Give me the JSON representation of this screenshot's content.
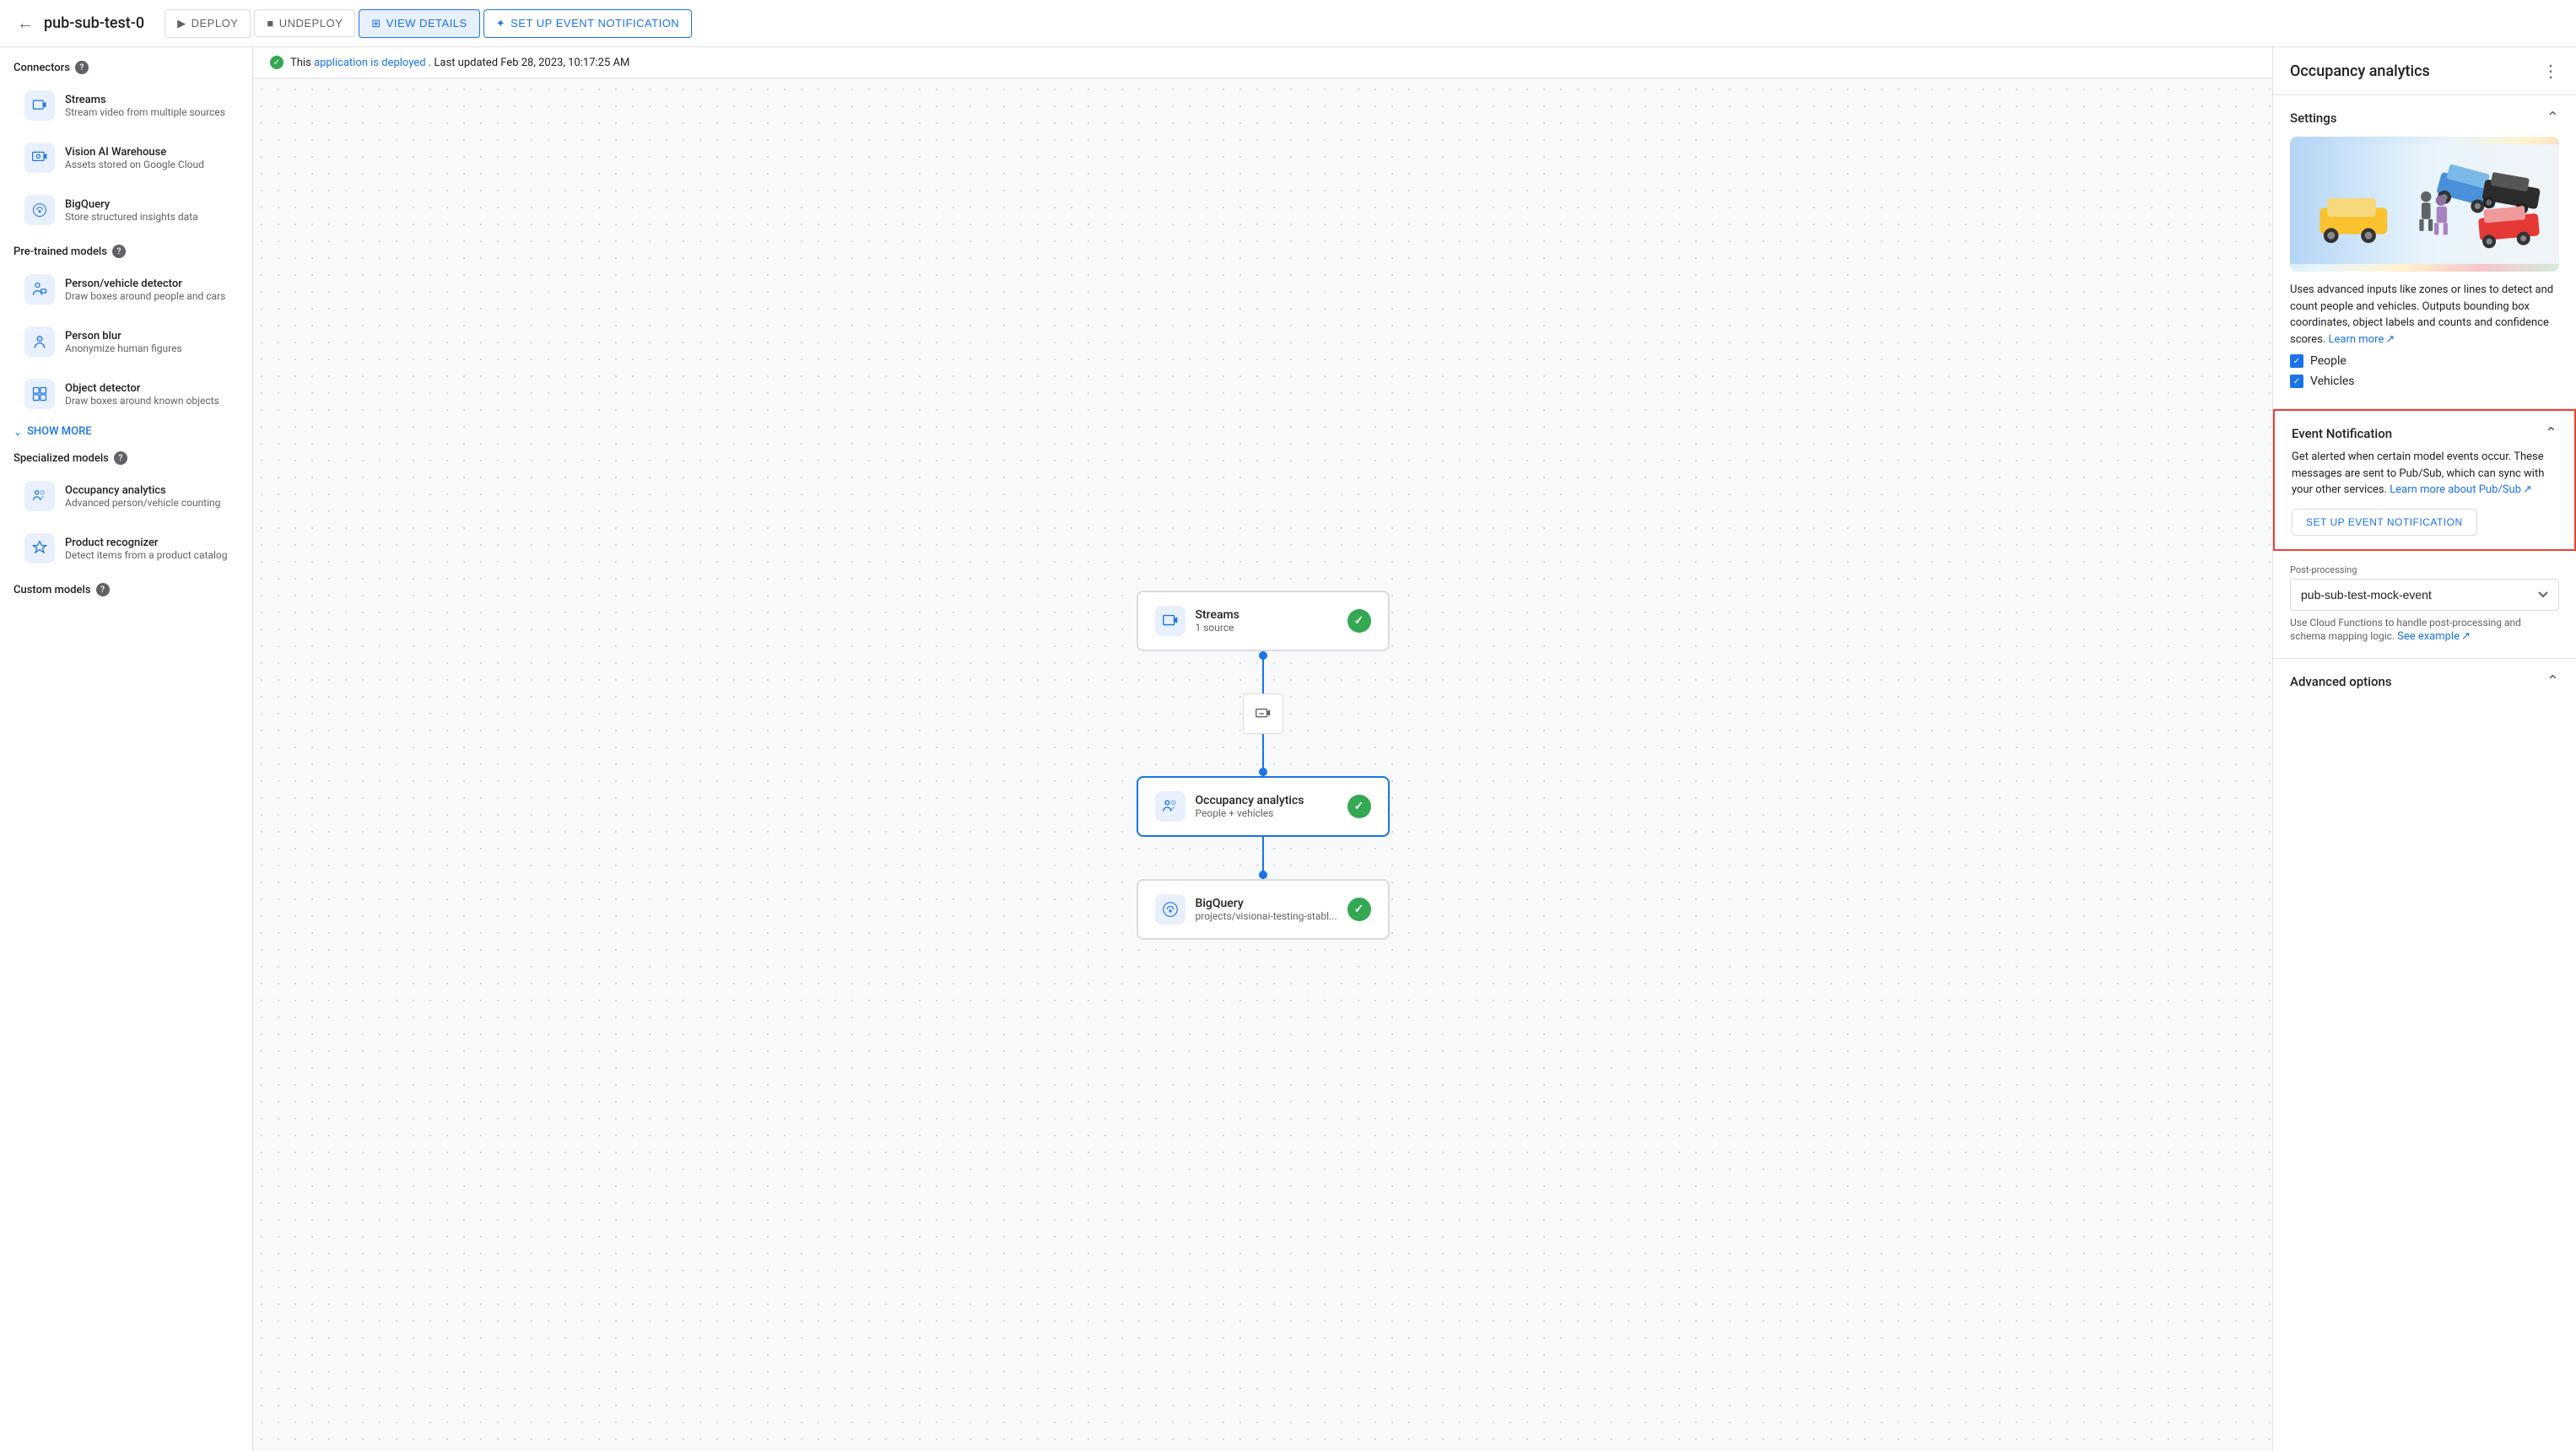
{
  "topbar": {
    "title": "pub-sub-test-0",
    "back_icon": "←",
    "buttons": [
      {
        "id": "deploy",
        "label": "DEPLOY",
        "icon": "▶",
        "style": "default"
      },
      {
        "id": "undeploy",
        "label": "UNDEPLOY",
        "icon": "■",
        "style": "default"
      },
      {
        "id": "view-details",
        "label": "VIEW DETAILS",
        "icon": "⊞",
        "style": "active"
      },
      {
        "id": "setup-event",
        "label": "SET UP EVENT NOTIFICATION",
        "icon": "✦",
        "style": "outlined-blue"
      }
    ]
  },
  "status_bar": {
    "text_prefix": "This",
    "link_text": "application is deployed",
    "text_suffix": ". Last updated Feb 28, 2023, 10:17:25 AM"
  },
  "sidebar": {
    "connectors_title": "Connectors",
    "connectors": [
      {
        "id": "streams",
        "name": "Streams",
        "desc": "Stream video from multiple sources",
        "icon_type": "streams"
      },
      {
        "id": "vision-ai",
        "name": "Vision AI Warehouse",
        "desc": "Assets stored on Google Cloud",
        "icon_type": "vision"
      },
      {
        "id": "bigquery",
        "name": "BigQuery",
        "desc": "Store structured insights data",
        "icon_type": "bq"
      }
    ],
    "pretrained_title": "Pre-trained models",
    "pretrained": [
      {
        "id": "person-vehicle",
        "name": "Person/vehicle detector",
        "desc": "Draw boxes around people and cars",
        "icon_type": "person"
      },
      {
        "id": "person-blur",
        "name": "Person blur",
        "desc": "Anonymize human figures",
        "icon_type": "blur"
      },
      {
        "id": "object-detector",
        "name": "Object detector",
        "desc": "Draw boxes around known objects",
        "icon_type": "object"
      }
    ],
    "show_more": "SHOW MORE",
    "specialized_title": "Specialized models",
    "specialized": [
      {
        "id": "occupancy",
        "name": "Occupancy analytics",
        "desc": "Advanced person/vehicle counting",
        "icon_type": "occupancy"
      },
      {
        "id": "product",
        "name": "Product recognizer",
        "desc": "Detect items from a product catalog",
        "icon_type": "product"
      }
    ],
    "custom_title": "Custom models"
  },
  "pipeline": {
    "nodes": [
      {
        "id": "streams-node",
        "name": "Streams",
        "sub": "1 source",
        "icon_type": "streams",
        "checked": true,
        "selected": false
      },
      {
        "id": "occupancy-node",
        "name": "Occupancy analytics",
        "sub": "People + vehicles",
        "icon_type": "occupancy",
        "checked": true,
        "selected": true
      },
      {
        "id": "bigquery-node",
        "name": "BigQuery",
        "sub": "projects/visionai-testing-stabl...",
        "icon_type": "bq",
        "checked": true,
        "selected": false
      }
    ]
  },
  "right_panel": {
    "title": "Occupancy analytics",
    "settings_title": "Settings",
    "description": "Uses advanced inputs like zones or lines to detect and count people and vehicles. Outputs bounding box coordinates, object labels and counts and confidence scores.",
    "learn_more_text": "Learn more",
    "checkboxes": [
      {
        "id": "people",
        "label": "People",
        "checked": true
      },
      {
        "id": "vehicles",
        "label": "Vehicles",
        "checked": true
      }
    ],
    "event_notification": {
      "title": "Event Notification",
      "description": "Get alerted when certain model events occur. These messages are sent to Pub/Sub, which can sync with your other services.",
      "learn_more_text": "Learn more about Pub/Sub",
      "setup_btn_label": "SET UP EVENT NOTIFICATION"
    },
    "post_processing": {
      "label": "Post-processing",
      "value": "pub-sub-test-mock-event",
      "helper_text": "Use Cloud Functions to handle post-processing and schema mapping logic.",
      "see_example_text": "See example"
    },
    "advanced_options": {
      "title": "Advanced options"
    }
  }
}
